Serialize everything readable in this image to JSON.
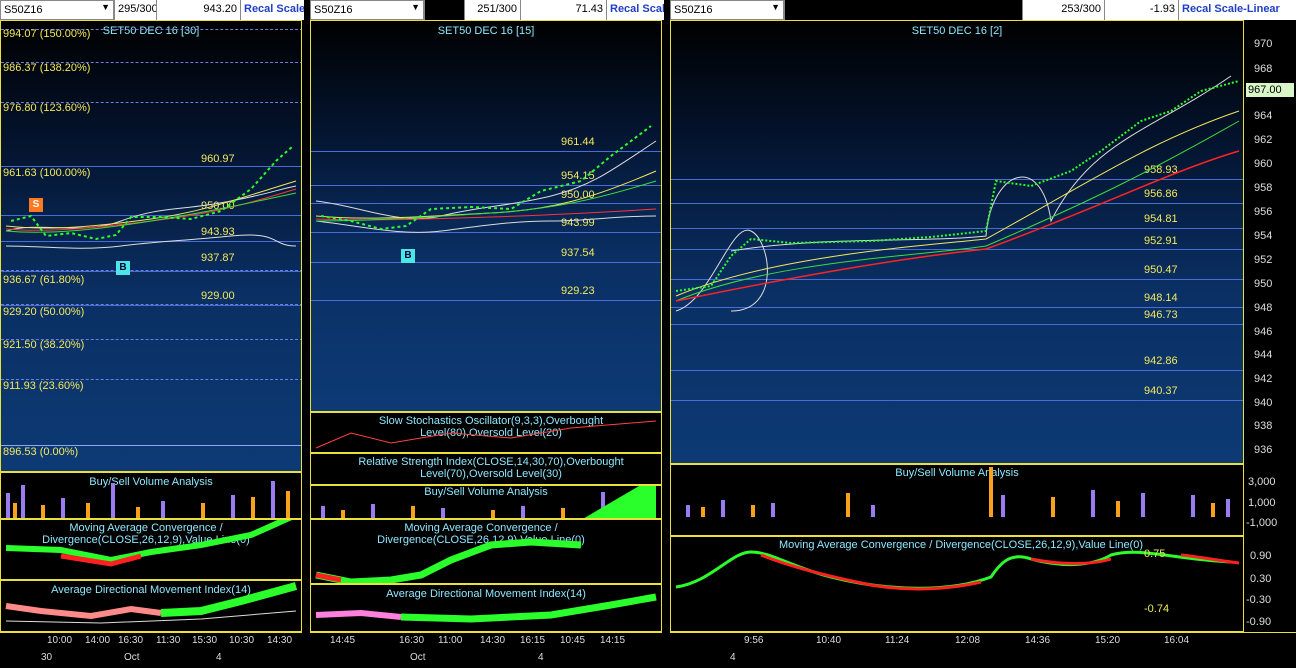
{
  "panel1": {
    "symbol": "S50Z16",
    "bars": "295/300",
    "value": "943.20",
    "recal": "Recal Scale",
    "title": "SET50 DEC 16   [30]",
    "fib": [
      "994.07 (150.00%)",
      "986.37 (138.20%)",
      "976.80 (123.60%)",
      "961.63 (100.00%)",
      "936.67 (61.80%)",
      "929.20 (50.00%)",
      "921.50 (38.20%)",
      "911.93 (23.60%)",
      "896.53 (0.00%)"
    ],
    "levels": [
      "960.97",
      "950.00",
      "943.93",
      "937.87",
      "929.00"
    ],
    "sig_s": "S",
    "sig_b": "B",
    "vol_title": "Buy/Sell Volume Analysis",
    "macd_title": "Moving Average Convergence / Divergence(CLOSE,26,12,9),Value Line(0)",
    "adx_title": "Average Directional Movement Index(14)",
    "times": [
      "10:00",
      "14:00",
      "16:30",
      "11:30",
      "15:30",
      "10:30",
      "14:30"
    ],
    "dates": [
      "30",
      "Oct",
      "4"
    ]
  },
  "panel2": {
    "symbol": "S50Z16",
    "bars": "251/300",
    "value": "71.43",
    "recal": "Recal Scale",
    "title": "SET50 DEC 16   [15]",
    "levels": [
      "961.44",
      "954.15",
      "950.00",
      "943.99",
      "937.54",
      "929.23"
    ],
    "sig_b": "B",
    "stoch_title": "Slow Stochastics Oscillator(9,3,3),Overbought Level(80),Oversold Level(20)",
    "rsi_title": "Relative Strength Index(CLOSE,14,30,70),Overbought Level(70),Oversold Level(30)",
    "vol_title": "Buy/Sell Volume Analysis",
    "macd_title": "Moving Average Convergence / Divergence(CLOSE,26,12,9),Value Line(0)",
    "adx_title": "Average Directional Movement Index(14)",
    "times": [
      "14:45",
      "16:30",
      "11:00",
      "14:30",
      "16:15",
      "10:45",
      "14:15"
    ],
    "dates": [
      "Oct",
      "4"
    ]
  },
  "panel3": {
    "symbol": "S50Z16",
    "bars": "253/300",
    "value": "-1.93",
    "recal": "Recal Scale-Linear",
    "title": "SET50 DEC 16   [2]",
    "levels": [
      "958.93",
      "956.86",
      "954.81",
      "952.91",
      "950.47",
      "948.14",
      "946.73",
      "942.86",
      "940.37"
    ],
    "yaxis": [
      "970",
      "968",
      "966",
      "964",
      "962",
      "960",
      "958",
      "956",
      "954",
      "952",
      "950",
      "948",
      "946",
      "944",
      "942",
      "940",
      "938",
      "936"
    ],
    "last_price": "967.00",
    "vol_title": "Buy/Sell Volume Analysis",
    "vol_axis": [
      "3,000",
      "1,000",
      "-1,000"
    ],
    "macd_title": "Moving Average Convergence / Divergence(CLOSE,26,12,9),Value Line(0)",
    "macd_axis": [
      "0.90",
      "0.30",
      "-0.30",
      "-0.90"
    ],
    "macd_vals": [
      "0.75",
      "-0.74"
    ],
    "times": [
      "9:56",
      "10:40",
      "11:24",
      "12:08",
      "14:36",
      "15:20",
      "16:04"
    ],
    "dates": [
      "4"
    ]
  },
  "colors": {
    "grid_line": "#4a6cd8",
    "frame": "#e9e13a",
    "label": "#f3e95b",
    "title": "#8ee8ff",
    "bull": "#2bff2b",
    "bear": "#ff2020",
    "ma_red": "#ff2424",
    "ma_yellow": "#f1e85a",
    "ma_green": "#3cdc3c",
    "vol_buy": "#f7a21a",
    "vol_sell": "#9b7cf0"
  }
}
